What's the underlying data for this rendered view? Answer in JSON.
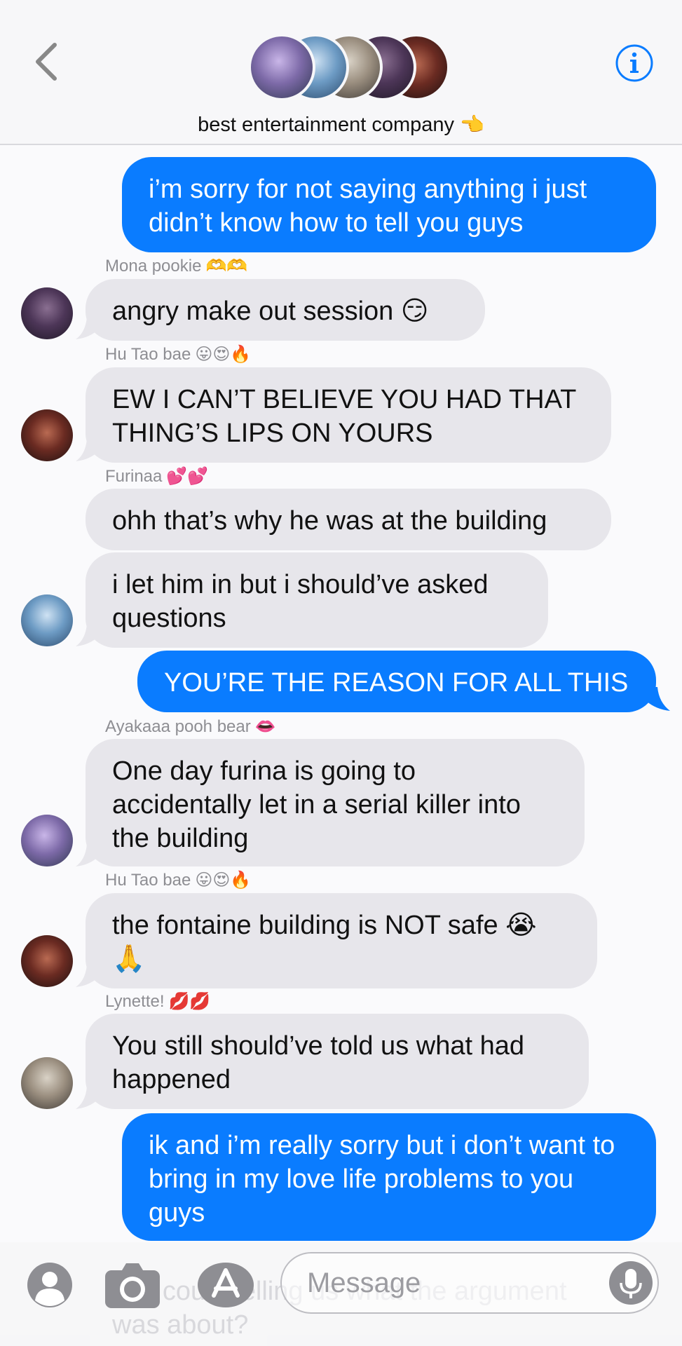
{
  "header": {
    "group_name": "best entertainment company",
    "group_emoji": "👈",
    "back_icon": "chevron-left-icon",
    "info_icon": "info-icon"
  },
  "messages": [
    {
      "direction": "out",
      "text": "i’m sorry for not saying anything i just didn’t know how to tell you guys"
    },
    {
      "direction": "in",
      "sender": "Mona pookie",
      "sender_emoji": "🫶🫶",
      "text": "angry make out session 😏"
    },
    {
      "direction": "in",
      "sender": "Hu Tao bae",
      "sender_emoji": "😛😍🔥",
      "text": "EW I CAN’T BELIEVE YOU HAD THAT THING’S LIPS ON YOURS"
    },
    {
      "direction": "in",
      "sender": "Furinaa",
      "sender_emoji": "💕💕",
      "text": "ohh that’s why he was at the building"
    },
    {
      "direction": "in",
      "text": "i let him in but i should’ve asked questions"
    },
    {
      "direction": "out",
      "text": "YOU’RE THE REASON FOR ALL THIS"
    },
    {
      "direction": "in",
      "sender": "Ayakaaa pooh bear",
      "sender_emoji": "👄",
      "text": "One day furina is going to accidentally let in a serial killer into the building"
    },
    {
      "direction": "in",
      "sender": "Hu Tao bae",
      "sender_emoji": "😛😍🔥",
      "text": "the fontaine building is NOT safe 😭 🙏"
    },
    {
      "direction": "in",
      "sender": "Lynette!",
      "sender_emoji": "💋💋",
      "text": "You still should’ve told us what had happened"
    },
    {
      "direction": "out",
      "text": "ik and i’m really sorry but i don’t want to bring in my love life problems to you guys"
    }
  ],
  "ghost_text": "you could telling us what the argument was about?",
  "composer": {
    "placeholder": "Message",
    "icons": [
      "contact-icon",
      "camera-icon",
      "app-store-icon",
      "microphone-icon"
    ]
  },
  "colors": {
    "outgoing": "#0a7cff",
    "incoming": "#e7e6eb",
    "accent": "#0a7cff"
  }
}
